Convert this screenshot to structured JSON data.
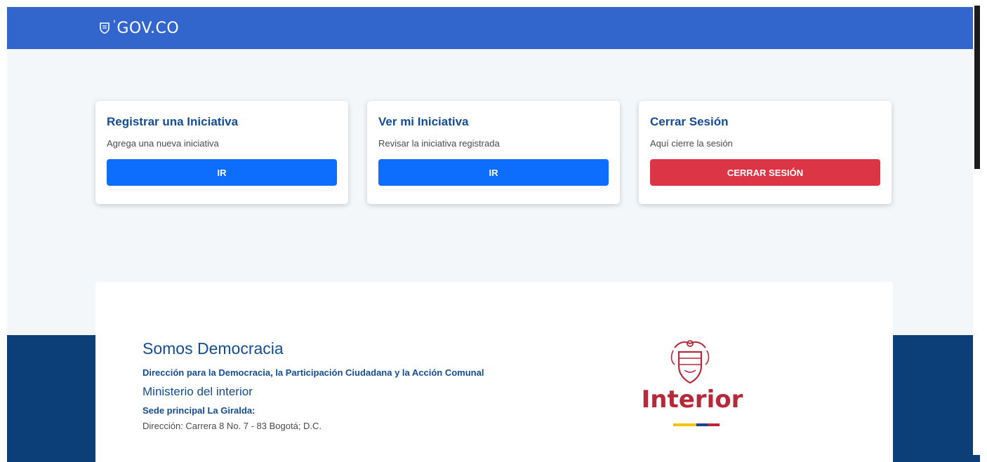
{
  "header": {
    "logo_text": "GOV.CO"
  },
  "cards": [
    {
      "title": "Registrar una Iniciativa",
      "description": "Agrega una nueva iniciativa",
      "button_label": "IR"
    },
    {
      "title": "Ver mi Iniciativa",
      "description": "Revisar la iniciativa registrada",
      "button_label": "IR"
    },
    {
      "title": "Cerrar Sesión",
      "description": "Aquí cierre la sesión",
      "button_label": "CERRAR SESIÓN"
    }
  ],
  "footer": {
    "title": "Somos Democracia",
    "department": "Dirección para la Democracia, la Participación Ciudadana y la Acción Comunal",
    "ministry": "Ministerio del interior",
    "sede_label": "Sede principal La Giralda:",
    "address": "Dirección: Carrera 8 No. 7 - 83 Bogotá; D.C.",
    "logo_text": "Interior"
  },
  "colors": {
    "header": "#3366cc",
    "primary_button": "#0d6efd",
    "danger_button": "#dc3545",
    "heading": "#134c93",
    "footer_band": "#0c3e77",
    "logo_red": "#b5293a"
  }
}
